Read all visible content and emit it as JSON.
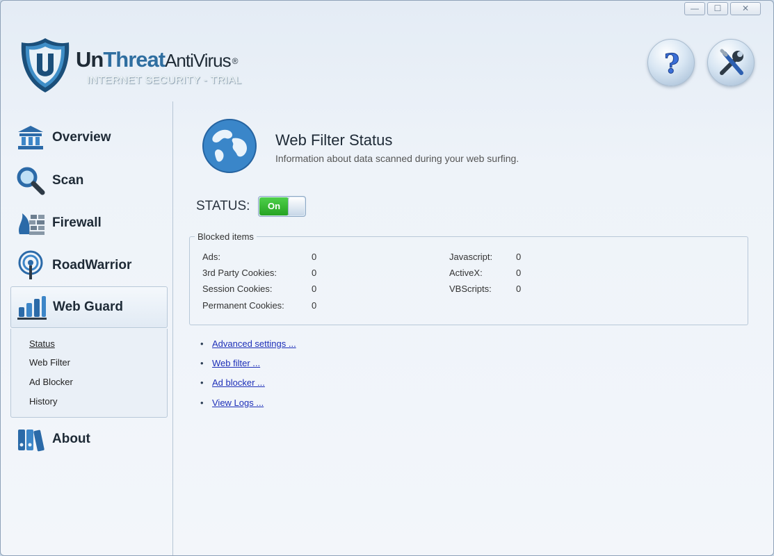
{
  "window": {
    "minimize": "—",
    "maximize": "☐",
    "close": "✕"
  },
  "brand": {
    "name_prefix": "Un",
    "name_middle": "Threat",
    "name_suffix": "AntiVirus",
    "reg": "®",
    "subtitle": "INTERNET SECURITY - TRIAL"
  },
  "header": {
    "help_icon": "question-mark-icon",
    "tools_icon": "wrench-screwdriver-icon"
  },
  "sidebar": {
    "items": [
      {
        "label": "Overview",
        "icon": "bank-building-icon"
      },
      {
        "label": "Scan",
        "icon": "magnifier-icon"
      },
      {
        "label": "Firewall",
        "icon": "brick-wall-flame-icon"
      },
      {
        "label": "RoadWarrior",
        "icon": "wireless-antenna-icon"
      },
      {
        "label": "Web Guard",
        "icon": "bar-chart-icon",
        "active": true
      },
      {
        "label": "About",
        "icon": "books-icon"
      }
    ],
    "subitems": [
      {
        "label": "Status",
        "current": true
      },
      {
        "label": "Web Filter"
      },
      {
        "label": "Ad Blocker"
      },
      {
        "label": "History"
      }
    ]
  },
  "main": {
    "title": "Web Filter Status",
    "description": "Information about data scanned during your web surfing.",
    "icon": "globe-icon",
    "status_label": "STATUS:",
    "toggle_label": "On",
    "blocked": {
      "legend": "Blocked items",
      "left": [
        {
          "label": "Ads:",
          "value": "0"
        },
        {
          "label": "3rd Party Cookies:",
          "value": "0"
        },
        {
          "label": "Session Cookies:",
          "value": "0"
        },
        {
          "label": "Permanent Cookies:",
          "value": "0"
        }
      ],
      "right": [
        {
          "label": "Javascript:",
          "value": "0"
        },
        {
          "label": "ActiveX:",
          "value": "0"
        },
        {
          "label": "VBScripts:",
          "value": "0"
        }
      ]
    },
    "links": [
      {
        "label": "Advanced settings ..."
      },
      {
        "label": "Web filter ..."
      },
      {
        "label": "Ad blocker ..."
      },
      {
        "label": "View Logs ..."
      }
    ]
  },
  "colors": {
    "accent": "#2f6ea0",
    "on_green": "#2fb52c",
    "link": "#1d2fb8"
  }
}
